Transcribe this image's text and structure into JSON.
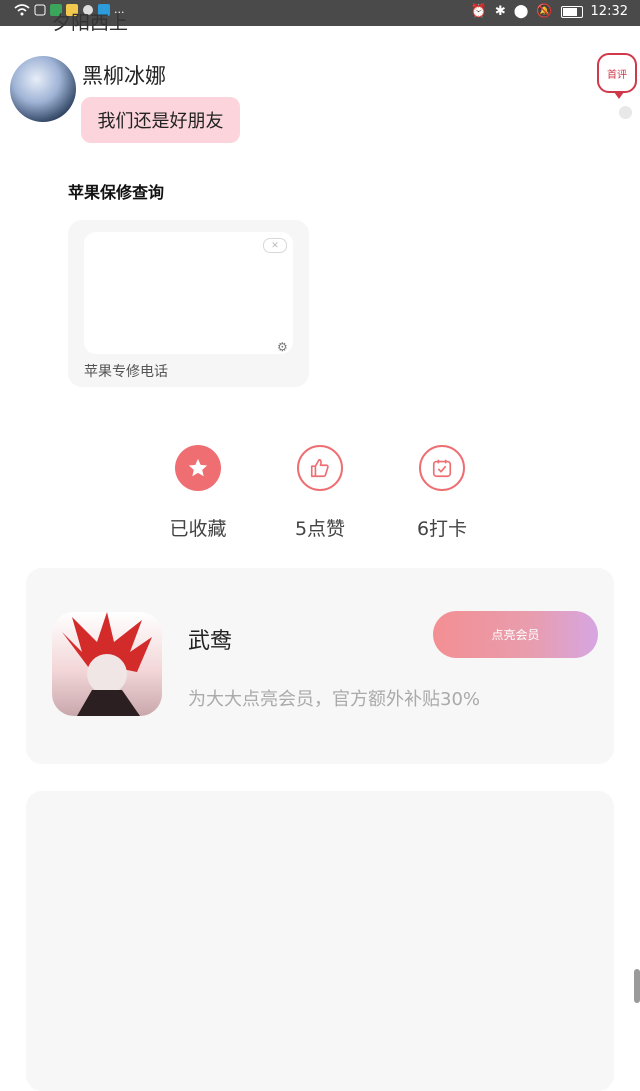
{
  "status_bar": {
    "time": "12:32",
    "more": "···"
  },
  "header": {
    "clipped_text": "夕阳西上"
  },
  "comment": {
    "username": "黑柳冰娜",
    "text": "我们还是好朋友",
    "first_comment_badge": "首评"
  },
  "section": {
    "title": "苹果保修查询",
    "card_caption": "苹果专修电话"
  },
  "actions": [
    {
      "label": "已收藏",
      "icon": "star-icon"
    },
    {
      "label": "5点赞",
      "icon": "thumbs-up-icon"
    },
    {
      "label": "6打卡",
      "icon": "calendar-check-icon"
    }
  ],
  "promo": {
    "name": "武鸯",
    "description": "为大大点亮会员，官方额外补贴30%",
    "button_label": "点亮会员"
  },
  "colors": {
    "accent": "#ee6e72",
    "bubble": "#fbd4dc",
    "badge": "#d0394a"
  }
}
